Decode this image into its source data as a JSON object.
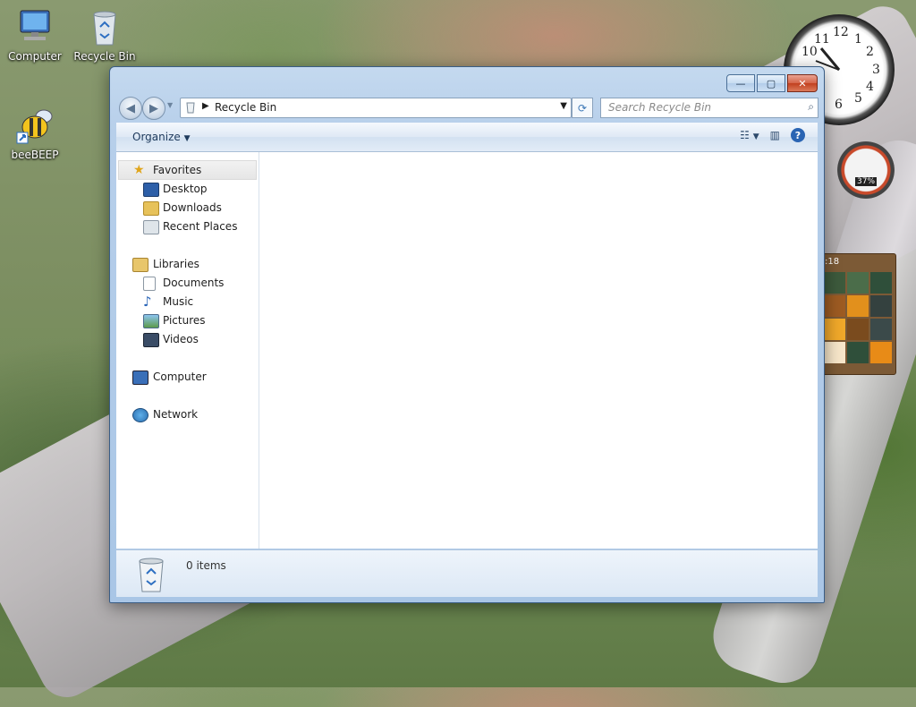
{
  "desktop": {
    "icons": [
      {
        "label": "Computer",
        "icon": "computer-icon"
      },
      {
        "label": "Recycle Bin",
        "icon": "recycle-bin-icon"
      },
      {
        "label": "beeBEEP",
        "icon": "beebeep-icon"
      }
    ]
  },
  "gadgets": {
    "clock_numbers": [
      "12",
      "1",
      "2",
      "3",
      "4",
      "5",
      "6",
      "10",
      "11"
    ],
    "meter_percent": "37%",
    "puzzle_time": ":18"
  },
  "window": {
    "caption_buttons": {
      "minimize": "—",
      "maximize": "▢",
      "close": "✕"
    },
    "address": {
      "path": "Recycle Bin"
    },
    "search": {
      "placeholder": "Search Recycle Bin"
    },
    "toolbar": {
      "organize": "Organize"
    },
    "nav": {
      "favorites": "Favorites",
      "desktop": "Desktop",
      "downloads": "Downloads",
      "recent_places": "Recent Places",
      "libraries": "Libraries",
      "documents": "Documents",
      "music": "Music",
      "pictures": "Pictures",
      "videos": "Videos",
      "computer": "Computer",
      "network": "Network"
    },
    "details": {
      "item_count": "0 items"
    }
  }
}
